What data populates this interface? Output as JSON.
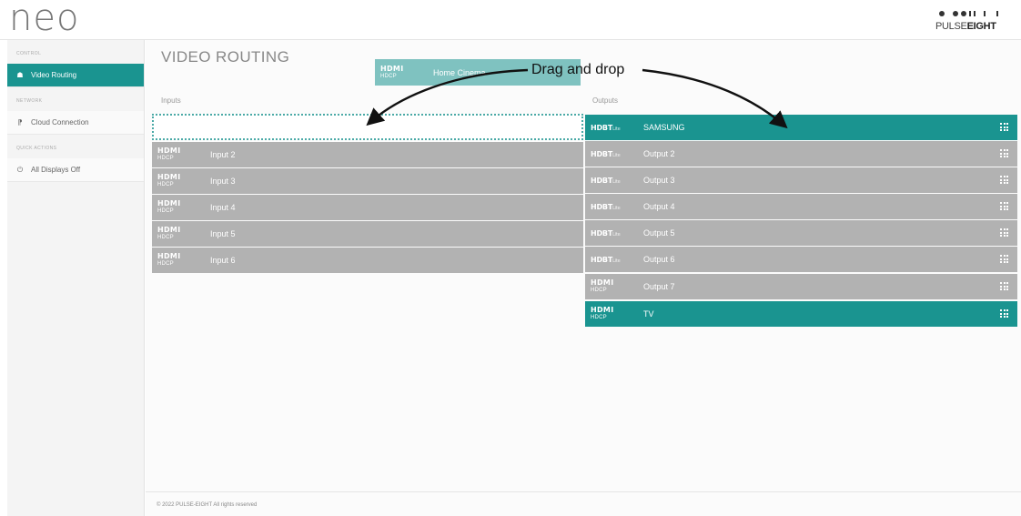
{
  "app": {
    "logo": "neo",
    "brand_name_a": "PULSE",
    "brand_name_b": "EIGHT"
  },
  "sidebar": {
    "sections": [
      {
        "title": "CONTROL",
        "items": [
          {
            "label": "Video Routing",
            "icon": "home-icon",
            "active": true
          }
        ]
      },
      {
        "title": "NETWORK",
        "items": [
          {
            "label": "Cloud Connection",
            "icon": "rss-icon",
            "active": false
          }
        ]
      },
      {
        "title": "QUICK ACTIONS",
        "items": [
          {
            "label": "All Displays Off",
            "icon": "power-icon",
            "active": false
          }
        ]
      }
    ]
  },
  "main": {
    "title": "VIDEO ROUTING",
    "inputs_label": "Inputs",
    "outputs_label": "Outputs",
    "dragged_item": {
      "label": "Home Cinema",
      "badge_a": "HDMI",
      "badge_b": "HDCP"
    },
    "inputs": [
      {
        "label": "Input 2",
        "badge_a": "HDMI",
        "badge_b": "HDCP"
      },
      {
        "label": "Input 3",
        "badge_a": "HDMI",
        "badge_b": "HDCP"
      },
      {
        "label": "Input 4",
        "badge_a": "HDMI",
        "badge_b": "HDCP"
      },
      {
        "label": "Input 5",
        "badge_a": "HDMI",
        "badge_b": "HDCP"
      },
      {
        "label": "Input 6",
        "badge_a": "HDMI",
        "badge_b": "HDCP"
      }
    ],
    "outputs": [
      {
        "label": "SAMSUNG",
        "type": "HDBT",
        "active": true
      },
      {
        "label": "Output 2",
        "type": "HDBT",
        "active": false
      },
      {
        "label": "Output 3",
        "type": "HDBT",
        "active": false
      },
      {
        "label": "Output 4",
        "type": "HDBT",
        "active": false
      },
      {
        "label": "Output 5",
        "type": "HDBT",
        "active": false
      },
      {
        "label": "Output 6",
        "type": "HDBT",
        "active": false
      },
      {
        "label": "Output 7",
        "type": "HDMI",
        "active": false
      },
      {
        "label": "TV",
        "type": "HDMI",
        "active": true
      }
    ],
    "hdbt_badge": "HDBT",
    "hdbt_suffix": "Lite",
    "footer": "© 2022 PULSE-EIGHT All rights reserved"
  },
  "annotation": {
    "text": "Drag and drop"
  },
  "colors": {
    "teal": "#1a9490",
    "grey": "#b2b2b2"
  }
}
